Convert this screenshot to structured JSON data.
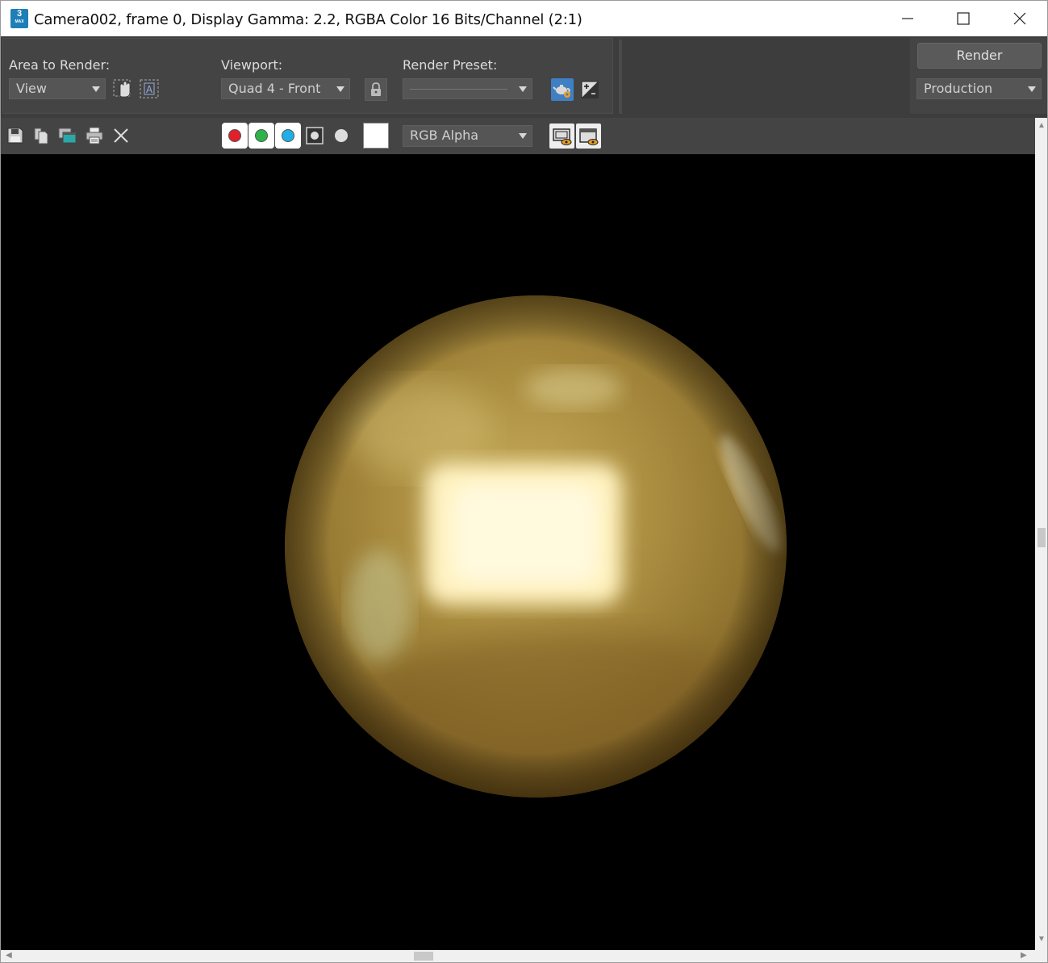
{
  "window": {
    "app_badge": "3",
    "app_badge_sub": "MAX",
    "title": "Camera002, frame 0, Display Gamma: 2.2, RGBA Color 16 Bits/Channel (2:1)",
    "controls": {
      "minimize": "—",
      "maximize": "☐",
      "close": "✕"
    }
  },
  "controls": {
    "area_label": "Area to Render:",
    "area_value": "View",
    "viewport_label": "Viewport:",
    "viewport_value": "Quad 4 - Front",
    "preset_label": "Render Preset:",
    "preset_value": "",
    "render_button": "Render",
    "render_mode": "Production"
  },
  "toolbar": {
    "channel_display": "RGB Alpha",
    "channel_colors": {
      "red": "#e0202a",
      "green": "#2db34a",
      "blue": "#1fb0e8"
    }
  },
  "render": {
    "sphere_colors": {
      "highlight": "#fff3c4",
      "base": "#b8963e",
      "shadow": "#6e5420"
    }
  }
}
